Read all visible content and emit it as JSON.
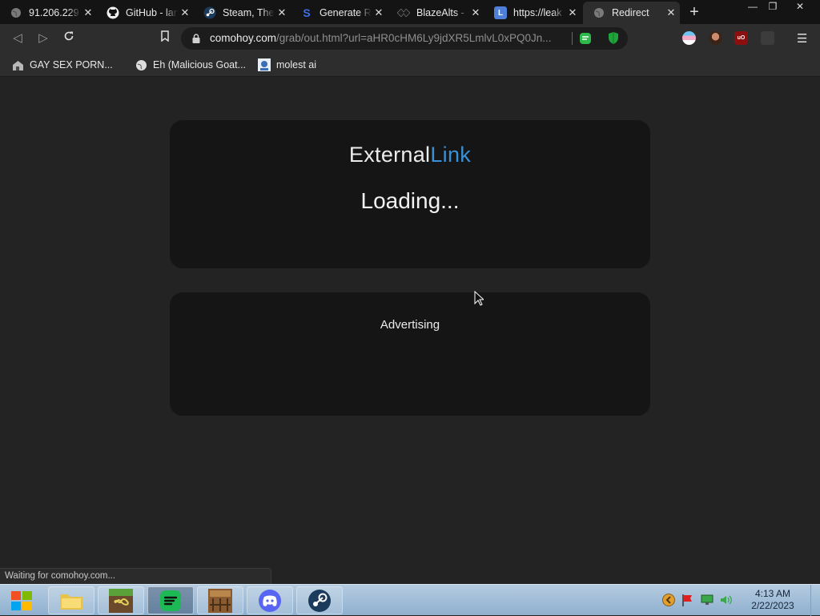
{
  "tabs": [
    {
      "title": "91.206.229",
      "icon": "globe-icon"
    },
    {
      "title": "GitHub - lan",
      "icon": "github-icon"
    },
    {
      "title": "Steam, The",
      "icon": "steam-icon"
    },
    {
      "title": "Generate Ro",
      "icon": "s-logo-icon"
    },
    {
      "title": "BlazeAlts - ",
      "icon": "blaze-icon"
    },
    {
      "title": "https://leak",
      "icon": "l-logo-icon"
    },
    {
      "title": "Redirect",
      "icon": "globe-icon"
    }
  ],
  "toolbar": {
    "url_host": "comohoy.com",
    "url_path": "/grab/out.html?url=aHR0cHM6Ly9jdXR5LmlvL0xPQ0Jn..."
  },
  "bookmarks": [
    {
      "label": "GAY SEX PORN...",
      "icon": "house-icon"
    },
    {
      "label": "Eh (Malicious Goat...",
      "icon": "globe-icon"
    },
    {
      "label": "molest ai",
      "icon": "image-icon"
    }
  ],
  "page": {
    "brand_part1": "External",
    "brand_part2": "Link",
    "loading_text": "Loading...",
    "ad_label": "Advertising",
    "accent_color": "#3a90d6"
  },
  "status": {
    "text": "Waiting for comohoy.com..."
  },
  "taskbar": {
    "apps": [
      "start-orb-icon",
      "file-explorer-icon",
      "minecraft-launcher-icon",
      "spotify-icon",
      "crafting-table-icon",
      "discord-icon",
      "steam-icon"
    ],
    "clock_time": "4:13 AM",
    "clock_date": "2/22/2023"
  }
}
